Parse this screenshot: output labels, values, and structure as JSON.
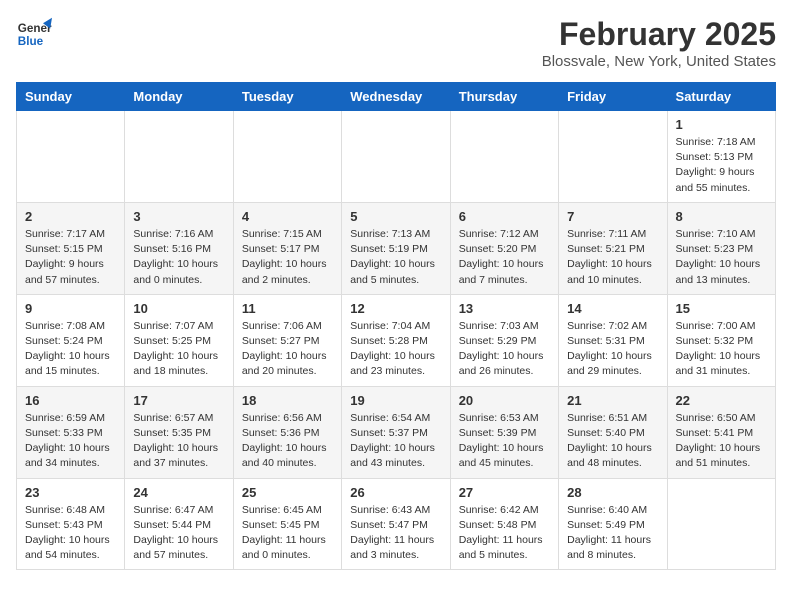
{
  "logo": {
    "line1": "General",
    "line2": "Blue"
  },
  "title": "February 2025",
  "subtitle": "Blossvale, New York, United States",
  "weekdays": [
    "Sunday",
    "Monday",
    "Tuesday",
    "Wednesday",
    "Thursday",
    "Friday",
    "Saturday"
  ],
  "weeks": [
    [
      {
        "day": "",
        "info": ""
      },
      {
        "day": "",
        "info": ""
      },
      {
        "day": "",
        "info": ""
      },
      {
        "day": "",
        "info": ""
      },
      {
        "day": "",
        "info": ""
      },
      {
        "day": "",
        "info": ""
      },
      {
        "day": "1",
        "info": "Sunrise: 7:18 AM\nSunset: 5:13 PM\nDaylight: 9 hours\nand 55 minutes."
      }
    ],
    [
      {
        "day": "2",
        "info": "Sunrise: 7:17 AM\nSunset: 5:15 PM\nDaylight: 9 hours\nand 57 minutes."
      },
      {
        "day": "3",
        "info": "Sunrise: 7:16 AM\nSunset: 5:16 PM\nDaylight: 10 hours\nand 0 minutes."
      },
      {
        "day": "4",
        "info": "Sunrise: 7:15 AM\nSunset: 5:17 PM\nDaylight: 10 hours\nand 2 minutes."
      },
      {
        "day": "5",
        "info": "Sunrise: 7:13 AM\nSunset: 5:19 PM\nDaylight: 10 hours\nand 5 minutes."
      },
      {
        "day": "6",
        "info": "Sunrise: 7:12 AM\nSunset: 5:20 PM\nDaylight: 10 hours\nand 7 minutes."
      },
      {
        "day": "7",
        "info": "Sunrise: 7:11 AM\nSunset: 5:21 PM\nDaylight: 10 hours\nand 10 minutes."
      },
      {
        "day": "8",
        "info": "Sunrise: 7:10 AM\nSunset: 5:23 PM\nDaylight: 10 hours\nand 13 minutes."
      }
    ],
    [
      {
        "day": "9",
        "info": "Sunrise: 7:08 AM\nSunset: 5:24 PM\nDaylight: 10 hours\nand 15 minutes."
      },
      {
        "day": "10",
        "info": "Sunrise: 7:07 AM\nSunset: 5:25 PM\nDaylight: 10 hours\nand 18 minutes."
      },
      {
        "day": "11",
        "info": "Sunrise: 7:06 AM\nSunset: 5:27 PM\nDaylight: 10 hours\nand 20 minutes."
      },
      {
        "day": "12",
        "info": "Sunrise: 7:04 AM\nSunset: 5:28 PM\nDaylight: 10 hours\nand 23 minutes."
      },
      {
        "day": "13",
        "info": "Sunrise: 7:03 AM\nSunset: 5:29 PM\nDaylight: 10 hours\nand 26 minutes."
      },
      {
        "day": "14",
        "info": "Sunrise: 7:02 AM\nSunset: 5:31 PM\nDaylight: 10 hours\nand 29 minutes."
      },
      {
        "day": "15",
        "info": "Sunrise: 7:00 AM\nSunset: 5:32 PM\nDaylight: 10 hours\nand 31 minutes."
      }
    ],
    [
      {
        "day": "16",
        "info": "Sunrise: 6:59 AM\nSunset: 5:33 PM\nDaylight: 10 hours\nand 34 minutes."
      },
      {
        "day": "17",
        "info": "Sunrise: 6:57 AM\nSunset: 5:35 PM\nDaylight: 10 hours\nand 37 minutes."
      },
      {
        "day": "18",
        "info": "Sunrise: 6:56 AM\nSunset: 5:36 PM\nDaylight: 10 hours\nand 40 minutes."
      },
      {
        "day": "19",
        "info": "Sunrise: 6:54 AM\nSunset: 5:37 PM\nDaylight: 10 hours\nand 43 minutes."
      },
      {
        "day": "20",
        "info": "Sunrise: 6:53 AM\nSunset: 5:39 PM\nDaylight: 10 hours\nand 45 minutes."
      },
      {
        "day": "21",
        "info": "Sunrise: 6:51 AM\nSunset: 5:40 PM\nDaylight: 10 hours\nand 48 minutes."
      },
      {
        "day": "22",
        "info": "Sunrise: 6:50 AM\nSunset: 5:41 PM\nDaylight: 10 hours\nand 51 minutes."
      }
    ],
    [
      {
        "day": "23",
        "info": "Sunrise: 6:48 AM\nSunset: 5:43 PM\nDaylight: 10 hours\nand 54 minutes."
      },
      {
        "day": "24",
        "info": "Sunrise: 6:47 AM\nSunset: 5:44 PM\nDaylight: 10 hours\nand 57 minutes."
      },
      {
        "day": "25",
        "info": "Sunrise: 6:45 AM\nSunset: 5:45 PM\nDaylight: 11 hours\nand 0 minutes."
      },
      {
        "day": "26",
        "info": "Sunrise: 6:43 AM\nSunset: 5:47 PM\nDaylight: 11 hours\nand 3 minutes."
      },
      {
        "day": "27",
        "info": "Sunrise: 6:42 AM\nSunset: 5:48 PM\nDaylight: 11 hours\nand 5 minutes."
      },
      {
        "day": "28",
        "info": "Sunrise: 6:40 AM\nSunset: 5:49 PM\nDaylight: 11 hours\nand 8 minutes."
      },
      {
        "day": "",
        "info": ""
      }
    ]
  ]
}
